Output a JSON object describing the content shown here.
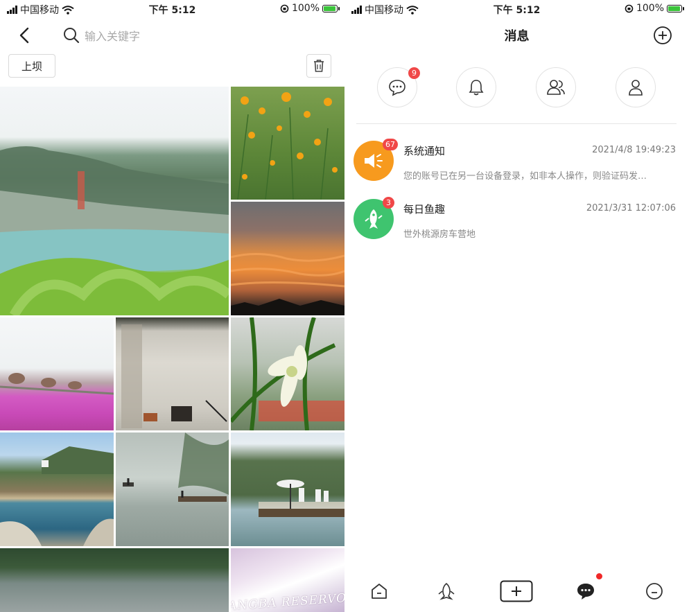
{
  "status_bar": {
    "carrier": "中国移动",
    "time": "下午 5:12",
    "battery": "100%",
    "battery_level": 1.0
  },
  "search_screen": {
    "search": {
      "placeholder": "输入关键字",
      "value": ""
    },
    "tag_label": "上坝",
    "icons": {
      "back": "chevron-left-icon",
      "search": "search-icon",
      "trash": "trash-icon"
    },
    "photos": [
      {
        "name": "photo-lake-hillside",
        "subject": "lake and hillside"
      },
      {
        "name": "photo-yellow-flowers",
        "subject": "yellow flowers"
      },
      {
        "name": "photo-sunset-clouds",
        "subject": "sunset clouds"
      },
      {
        "name": "photo-pink-flower-field",
        "subject": "pink flower field"
      },
      {
        "name": "photo-old-wall",
        "subject": "old white wall"
      },
      {
        "name": "photo-white-orchid",
        "subject": "white orchid"
      },
      {
        "name": "photo-reservoir-bank",
        "subject": "reservoir bank"
      },
      {
        "name": "photo-misty-fishing",
        "subject": "misty lake fishing"
      },
      {
        "name": "photo-fishing-raft",
        "subject": "fishing raft"
      },
      {
        "name": "photo-dark-lake",
        "subject": "dark lake"
      },
      {
        "name": "photo-reservoir-sign",
        "subject": "reservoir sky"
      }
    ],
    "watermark_text": "ANGBA RESERVO"
  },
  "messages_screen": {
    "title": "消息",
    "quick_actions": [
      {
        "name": "comments",
        "icon": "chat-bubble-icon",
        "badge": "9"
      },
      {
        "name": "notifications",
        "icon": "bell-icon",
        "badge": ""
      },
      {
        "name": "contacts",
        "icon": "people-icon",
        "badge": ""
      },
      {
        "name": "profile",
        "icon": "person-icon",
        "badge": ""
      }
    ],
    "messages": [
      {
        "title": "系统通知",
        "time": "2021/4/8 19:49:23",
        "preview": "您的账号已在另一台设备登录，如非本人操作，则验证码发…",
        "badge": "67",
        "avatar_color": "#f79a1e",
        "icon": "speaker-icon"
      },
      {
        "title": "每日鱼趣",
        "time": "2021/3/31 12:07:06",
        "preview": "世外桃源房车营地",
        "badge": "3",
        "avatar_color": "#3fc46f",
        "icon": "fish-icon"
      }
    ],
    "tab_bar": [
      {
        "name": "home",
        "icon": "home-icon"
      },
      {
        "name": "discover",
        "icon": "fish-outline-icon"
      },
      {
        "name": "publish",
        "icon": "plus-icon"
      },
      {
        "name": "messages",
        "icon": "message-icon",
        "dot": true
      },
      {
        "name": "me",
        "icon": "face-icon"
      }
    ]
  },
  "colors": {
    "badge": "#f04848",
    "accent_orange": "#f79a1e",
    "accent_green": "#3fc46f",
    "border": "#d8d8d8"
  }
}
